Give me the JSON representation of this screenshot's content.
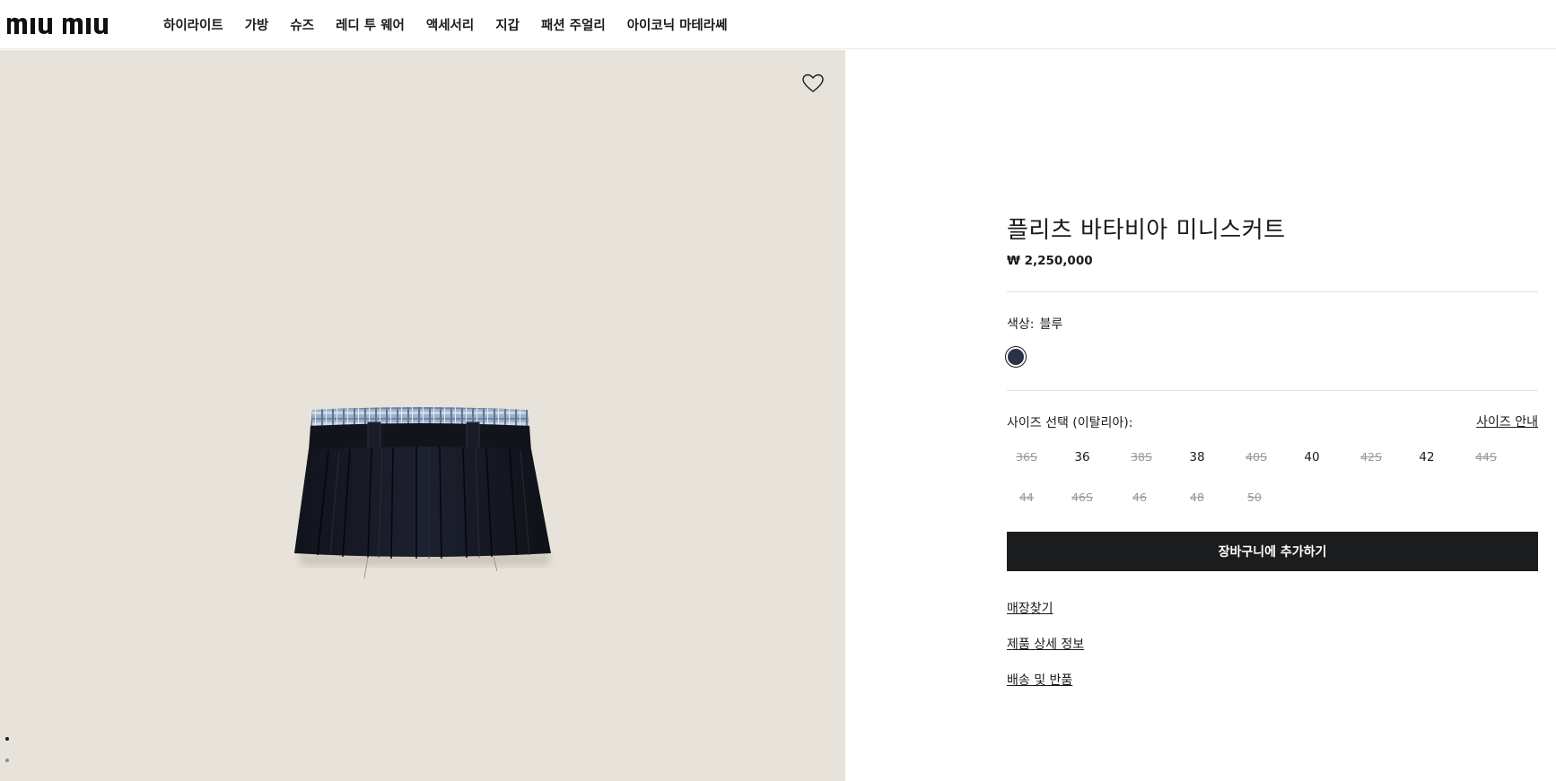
{
  "brand": {
    "logo_text": "miu miu"
  },
  "nav": {
    "items": [
      {
        "label": "하이라이트"
      },
      {
        "label": "가방"
      },
      {
        "label": "슈즈"
      },
      {
        "label": "레디 투 웨어"
      },
      {
        "label": "액세서리"
      },
      {
        "label": "지갑"
      },
      {
        "label": "패션 주얼리"
      },
      {
        "label": "아이코닉 마테라쎄"
      }
    ]
  },
  "gallery": {
    "wishlist_icon": "heart-icon",
    "background_color": "#e8e3da",
    "current_slide": 1,
    "slide_count": 2
  },
  "product": {
    "title": "플리츠 바타비아 미니스커트",
    "price": "₩ 2,250,000",
    "color_label": "색상:",
    "color_value": "블루",
    "swatch_color": "#2a3246",
    "size_label": "사이즈 선택 (이탈리아):",
    "size_guide": "사이즈 안내",
    "sizes": [
      {
        "label": "36S",
        "available": false
      },
      {
        "label": "36",
        "available": true
      },
      {
        "label": "38S",
        "available": false
      },
      {
        "label": "38",
        "available": true
      },
      {
        "label": "40S",
        "available": false
      },
      {
        "label": "40",
        "available": true
      },
      {
        "label": "42S",
        "available": false
      },
      {
        "label": "42",
        "available": true
      },
      {
        "label": "44S",
        "available": false
      },
      {
        "label": "44",
        "available": false
      },
      {
        "label": "46S",
        "available": false
      },
      {
        "label": "46",
        "available": false
      },
      {
        "label": "48",
        "available": false
      },
      {
        "label": "50",
        "available": false
      }
    ],
    "add_to_cart": "장바구니에 추가하기",
    "links": [
      "매장찾기",
      "제품 상세 정보",
      "배송 및 반품"
    ]
  }
}
